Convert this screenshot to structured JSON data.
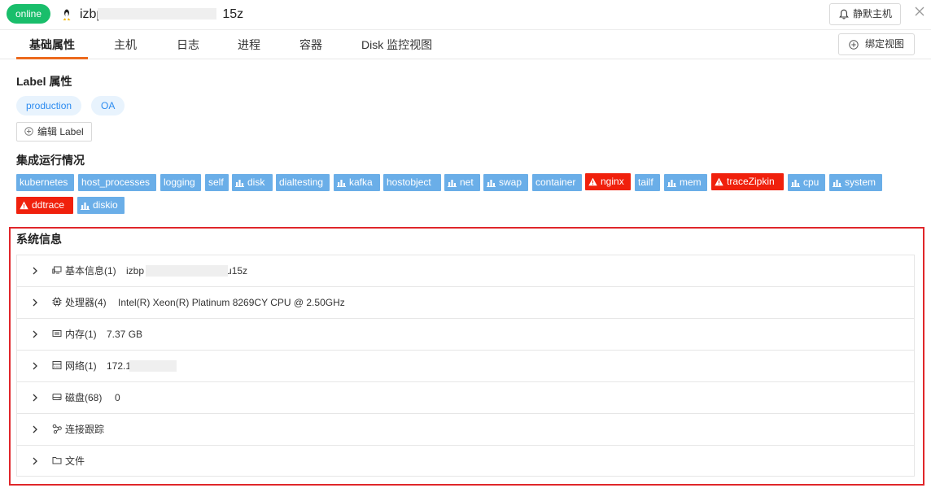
{
  "header": {
    "status_badge": "online",
    "host_name_prefix": "izbp",
    "host_name_suffix": "15z",
    "silence_button": "静默主机"
  },
  "tabs": [
    {
      "label": "基础属性",
      "active": true
    },
    {
      "label": "主机",
      "active": false
    },
    {
      "label": "日志",
      "active": false
    },
    {
      "label": "进程",
      "active": false
    },
    {
      "label": "容器",
      "active": false
    },
    {
      "label": "Disk 监控视图",
      "active": false
    }
  ],
  "bind_view_button": "绑定视图",
  "labels_section": {
    "title": "Label 属性",
    "tags": [
      "production",
      "OA"
    ],
    "edit_button": "编辑 Label"
  },
  "integrations_section": {
    "title": "集成运行情况",
    "items": [
      {
        "name": "kubernetes",
        "status": "ok",
        "icon": "none"
      },
      {
        "name": "host_processes",
        "status": "ok",
        "icon": "none"
      },
      {
        "name": "logging",
        "status": "ok",
        "icon": "none"
      },
      {
        "name": "self",
        "status": "ok",
        "icon": "none"
      },
      {
        "name": "disk",
        "status": "ok",
        "icon": "bar-chart-icon"
      },
      {
        "name": "dialtesting",
        "status": "ok",
        "icon": "none"
      },
      {
        "name": "kafka",
        "status": "ok",
        "icon": "bar-chart-icon"
      },
      {
        "name": "hostobject",
        "status": "ok",
        "icon": "none"
      },
      {
        "name": "net",
        "status": "ok",
        "icon": "bar-chart-icon"
      },
      {
        "name": "swap",
        "status": "ok",
        "icon": "bar-chart-icon"
      },
      {
        "name": "container",
        "status": "ok",
        "icon": "none"
      },
      {
        "name": "nginx",
        "status": "error",
        "icon": "warning-icon"
      },
      {
        "name": "tailf",
        "status": "ok",
        "icon": "none"
      },
      {
        "name": "mem",
        "status": "ok",
        "icon": "bar-chart-icon"
      },
      {
        "name": "traceZipkin",
        "status": "error",
        "icon": "warning-icon"
      },
      {
        "name": "cpu",
        "status": "ok",
        "icon": "bar-chart-icon"
      },
      {
        "name": "system",
        "status": "ok",
        "icon": "bar-chart-icon"
      },
      {
        "name": "ddtrace",
        "status": "error",
        "icon": "warning-icon"
      },
      {
        "name": "diskio",
        "status": "ok",
        "icon": "bar-chart-icon"
      }
    ],
    "colors": {
      "ok": "#6aaee8",
      "error": "#f0200c"
    }
  },
  "system_info": {
    "title": "系统信息",
    "rows": [
      {
        "label": "基本信息(1)",
        "value_prefix": "izbp",
        "value_suffix": "u15z",
        "icon": "host-icon"
      },
      {
        "label": "处理器(4)",
        "value": "Intel(R) Xeon(R) Platinum 8269CY CPU @ 2.50GHz",
        "icon": "cpu-icon"
      },
      {
        "label": "内存(1)",
        "value": "7.37 GB",
        "icon": "memory-icon"
      },
      {
        "label": "网络(1)",
        "value": "172.1",
        "icon": "network-icon"
      },
      {
        "label": "磁盘(68)",
        "value": "0",
        "icon": "disk-icon"
      },
      {
        "label": "连接跟踪",
        "value": "",
        "icon": "connection-icon"
      },
      {
        "label": "文件",
        "value": "",
        "icon": "folder-icon"
      }
    ]
  },
  "colors": {
    "online": "#19be6b",
    "active_tab": "#ec6a1d",
    "label_tag_bg": "#e8f3fd",
    "label_tag_text": "#2d8cf0",
    "highlight_frame": "#e0262a"
  }
}
